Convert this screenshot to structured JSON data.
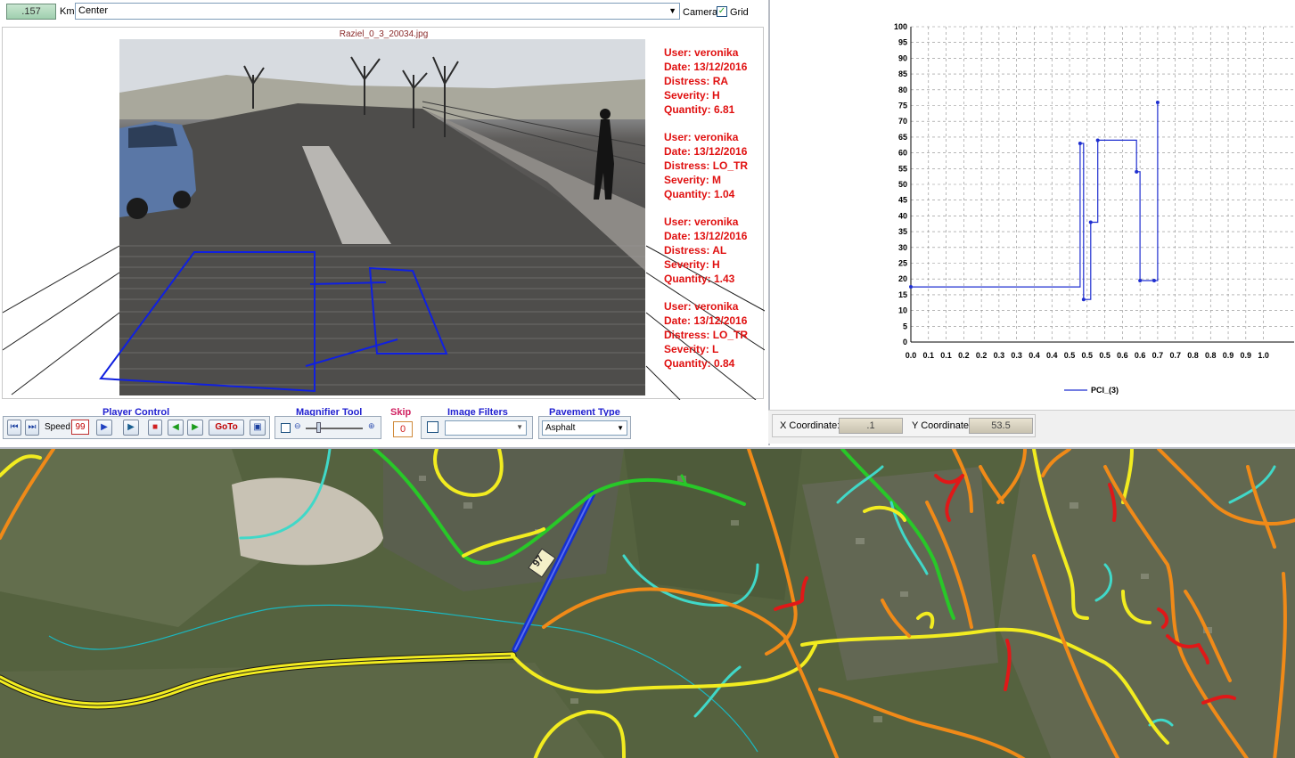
{
  "topbar": {
    "km_value": ".157",
    "km_label": "Km",
    "position_value": "Center",
    "camera_label": "Camera",
    "grid_label": "Grid",
    "grid_checked_mark": "✓"
  },
  "viewer": {
    "filename": "Raziel_0_3_20034.jpg",
    "records": [
      {
        "user": "User: veronika",
        "date": "Date: 13/12/2016",
        "distress": "Distress: RA",
        "severity": "Severity: H",
        "quantity": "Quantity: 6.81"
      },
      {
        "user": "User: veronika",
        "date": "Date: 13/12/2016",
        "distress": "Distress: LO_TR",
        "severity": "Severity: M",
        "quantity": "Quantity: 1.04"
      },
      {
        "user": "User: veronika",
        "date": "Date: 13/12/2016",
        "distress": "Distress: AL",
        "severity": "Severity: H",
        "quantity": "Quantity: 1.43"
      },
      {
        "user": "User: veronika",
        "date": "Date: 13/12/2016",
        "distress": "Distress: LO_TR",
        "severity": "Severity: L",
        "quantity": "Quantity: 0.84"
      }
    ]
  },
  "controls": {
    "player_title": "Player Control",
    "speed_label": "Speed",
    "speed_value": "99",
    "goto_label": "GoTo",
    "magnifier_title": "Magnifier Tool",
    "skip_title": "Skip",
    "skip_value": "0",
    "filters_title": "Image Filters",
    "pavement_title": "Pavement Type",
    "pavement_value": "Asphalt"
  },
  "chart_data": {
    "type": "line",
    "series": [
      {
        "name": "PCI_(3)",
        "color": "#1f2fd0",
        "step": true,
        "points": [
          [
            0.0,
            17.5
          ],
          [
            0.48,
            17.5
          ],
          [
            0.48,
            63
          ],
          [
            0.49,
            63
          ],
          [
            0.49,
            13.5
          ],
          [
            0.51,
            13.5
          ],
          [
            0.51,
            38
          ],
          [
            0.53,
            38
          ],
          [
            0.53,
            64
          ],
          [
            0.64,
            64
          ],
          [
            0.64,
            54
          ],
          [
            0.65,
            54
          ],
          [
            0.65,
            19.5
          ],
          [
            0.69,
            19.5
          ],
          [
            0.69,
            19.5
          ],
          [
            0.7,
            19.5
          ],
          [
            0.7,
            76
          ]
        ]
      }
    ],
    "xlim": [
      0.0,
      1.0
    ],
    "ylim": [
      0,
      100
    ],
    "x_ticks": [
      "0.0",
      "0.1",
      "0.1",
      "0.2",
      "0.2",
      "0.3",
      "0.3",
      "0.4",
      "0.4",
      "0.5",
      "0.5",
      "0.5",
      "0.6",
      "0.6",
      "0.7",
      "0.7",
      "0.8",
      "0.8",
      "0.9",
      "0.9",
      "1.0"
    ],
    "y_ticks": [
      "0",
      "5",
      "10",
      "15",
      "20",
      "25",
      "30",
      "35",
      "40",
      "45",
      "50",
      "55",
      "60",
      "65",
      "70",
      "75",
      "80",
      "85",
      "90",
      "95",
      "100"
    ],
    "grid": true,
    "legend": "bottom"
  },
  "coords": {
    "x_label": "X Coordinate:",
    "x_value": ".1",
    "y_label": "Y Coordinate:",
    "y_value": "53.5"
  },
  "map": {
    "labels": [
      "97"
    ]
  }
}
